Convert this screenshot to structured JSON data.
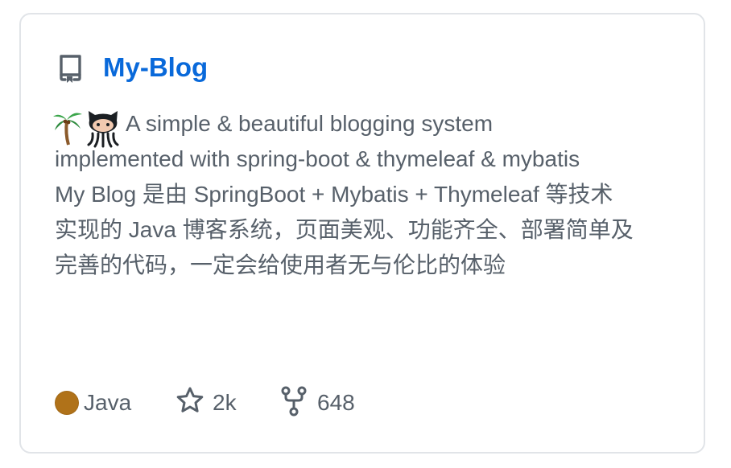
{
  "repo": {
    "name": "My-Blog",
    "icon": "repo-icon"
  },
  "description": {
    "emojis": [
      "palm-tree-emoji",
      "octocat-emoji"
    ],
    "lines": [
      "A simple & beautiful blogging system",
      "implemented with spring-boot & thymeleaf & mybatis",
      "My Blog 是由 SpringBoot + Mybatis + Thymeleaf 等技术",
      "实现的 Java 博客系统，页面美观、功能齐全、部署简单及",
      "完善的代码，一定会给使用者无与伦比的体验"
    ]
  },
  "meta": {
    "language": "Java",
    "language_color": "#b07219",
    "stars": "2k",
    "forks": "648",
    "star_icon": "star-icon",
    "fork_icon": "fork-icon"
  },
  "colors": {
    "link": "#0969da",
    "text": "#57606a",
    "border": "#e1e4e8"
  }
}
